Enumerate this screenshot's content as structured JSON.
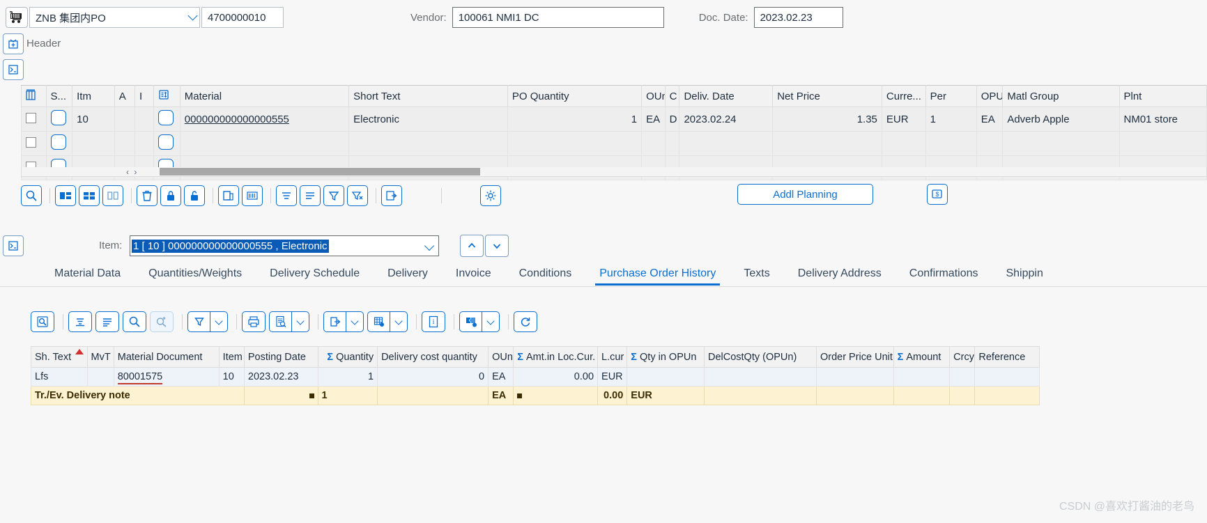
{
  "header": {
    "cart_icon": "shopping-cart-icon",
    "doc_type": "ZNB 集团内PO",
    "po_number": "4700000010",
    "vendor_label": "Vendor:",
    "vendor_value": "100061 NMI1 DC",
    "doc_date_label": "Doc. Date:",
    "doc_date_value": "2023.02.23",
    "header_section_label": "Header",
    "expand_icon": "expand-header-icon",
    "collapse_icon": "collapse-panel-icon"
  },
  "items_grid": {
    "columns": [
      "",
      "S...",
      "Itm",
      "A",
      "I",
      "",
      "Material",
      "Short Text",
      "PO Quantity",
      "OUn",
      "C",
      "Deliv. Date",
      "Net Price",
      "Curre...",
      "Per",
      "OPU",
      "Matl Group",
      "Plnt"
    ],
    "rows": [
      {
        "itm": "10",
        "a": "",
        "i": "",
        "material": "000000000000000555",
        "short_text": "Electronic",
        "po_quantity": "1",
        "oun": "EA",
        "c": "D",
        "deliv_date": "2023.02.24",
        "net_price": "1.35",
        "currency": "EUR",
        "per": "1",
        "opu": "EA",
        "matl_group": "Adverb Apple",
        "plnt": "NM01 store"
      },
      {
        "itm": "",
        "a": "",
        "i": "",
        "material": "",
        "short_text": "",
        "po_quantity": "",
        "oun": "",
        "c": "",
        "deliv_date": "",
        "net_price": "",
        "currency": "",
        "per": "",
        "opu": "",
        "matl_group": "",
        "plnt": ""
      },
      {
        "itm": "",
        "a": "",
        "i": "",
        "material": "",
        "short_text": "",
        "po_quantity": "",
        "oun": "",
        "c": "",
        "deliv_date": "",
        "net_price": "",
        "currency": "",
        "per": "",
        "opu": "",
        "matl_group": "",
        "plnt": ""
      }
    ]
  },
  "mid_toolbar": {
    "buttons": [
      "search-magnifier-icon",
      "layout-columns-icon",
      "layout-grid-icon",
      "layout-split-icon",
      "delete-trash-icon",
      "lock-closed-icon",
      "lock-open-icon",
      "copy-icon",
      "barcode-icon",
      "sort-lines-icon",
      "filter-lines-icon",
      "filter-funnel-icon",
      "filter-clear-icon",
      "export-icon",
      "settings-gear-icon"
    ],
    "addl_planning_label": "Addl Planning",
    "money_icon": "price-tag-icon"
  },
  "item_selector": {
    "label": "Item:",
    "value": "1 [ 10 ] 000000000000000555 , Electronic",
    "prev_icon": "chevron-up-icon",
    "next_icon": "chevron-down-icon",
    "side_icon": "collapse-panel-icon"
  },
  "tabs": {
    "items": [
      "Material Data",
      "Quantities/Weights",
      "Delivery Schedule",
      "Delivery",
      "Invoice",
      "Conditions",
      "Purchase Order History",
      "Texts",
      "Delivery Address",
      "Confirmations",
      "Shippin"
    ],
    "active_index": 6
  },
  "bottom_toolbar": {
    "buttons": [
      "detail-magnifier-icon",
      "sort-ascending-icon",
      "filter-lines-icon",
      "search-icon",
      "search-plus-icon"
    ],
    "split_buttons": [
      "filter-funnel-icon",
      "print-icon",
      "preview-document-icon",
      "export-to-icon",
      "spreadsheet-settings-icon"
    ],
    "info_icon": "info-icon",
    "puzzle_icon": "puzzle-addin-icon",
    "refresh_icon": "refresh-icon"
  },
  "history_table": {
    "columns": [
      "Sh. Text",
      "MvT",
      "Material Document",
      "Item",
      "Posting Date",
      "Quantity",
      "Delivery cost quantity",
      "OUn",
      "Amt.in Loc.Cur.",
      "L.cur",
      "Qty in OPUn",
      "DelCostQty (OPUn)",
      "Order Price Unit",
      "Amount",
      "Crcy",
      "Reference"
    ],
    "sigma_columns": [
      5,
      8,
      10,
      13
    ],
    "sort_column": 0,
    "rows": [
      {
        "sh_text": "Lfs",
        "mvt": "",
        "material_document": "80001575",
        "item": "10",
        "posting_date": "2023.02.23",
        "quantity": "1",
        "delivery_cost_quantity": "0",
        "oun": "EA",
        "amt_loc_cur": "0.00",
        "l_cur": "EUR",
        "qty_in_opun": "",
        "delcostqty_opun": "",
        "order_price_unit": "",
        "amount": "",
        "crcy": "",
        "reference": ""
      }
    ],
    "total_row": {
      "label": "Tr./Ev. Delivery note",
      "quantity": "1",
      "oun": "EA",
      "amt_loc_cur": "0.00",
      "l_cur": "EUR"
    }
  },
  "watermark": "CSDN @喜欢打酱油的老鸟"
}
